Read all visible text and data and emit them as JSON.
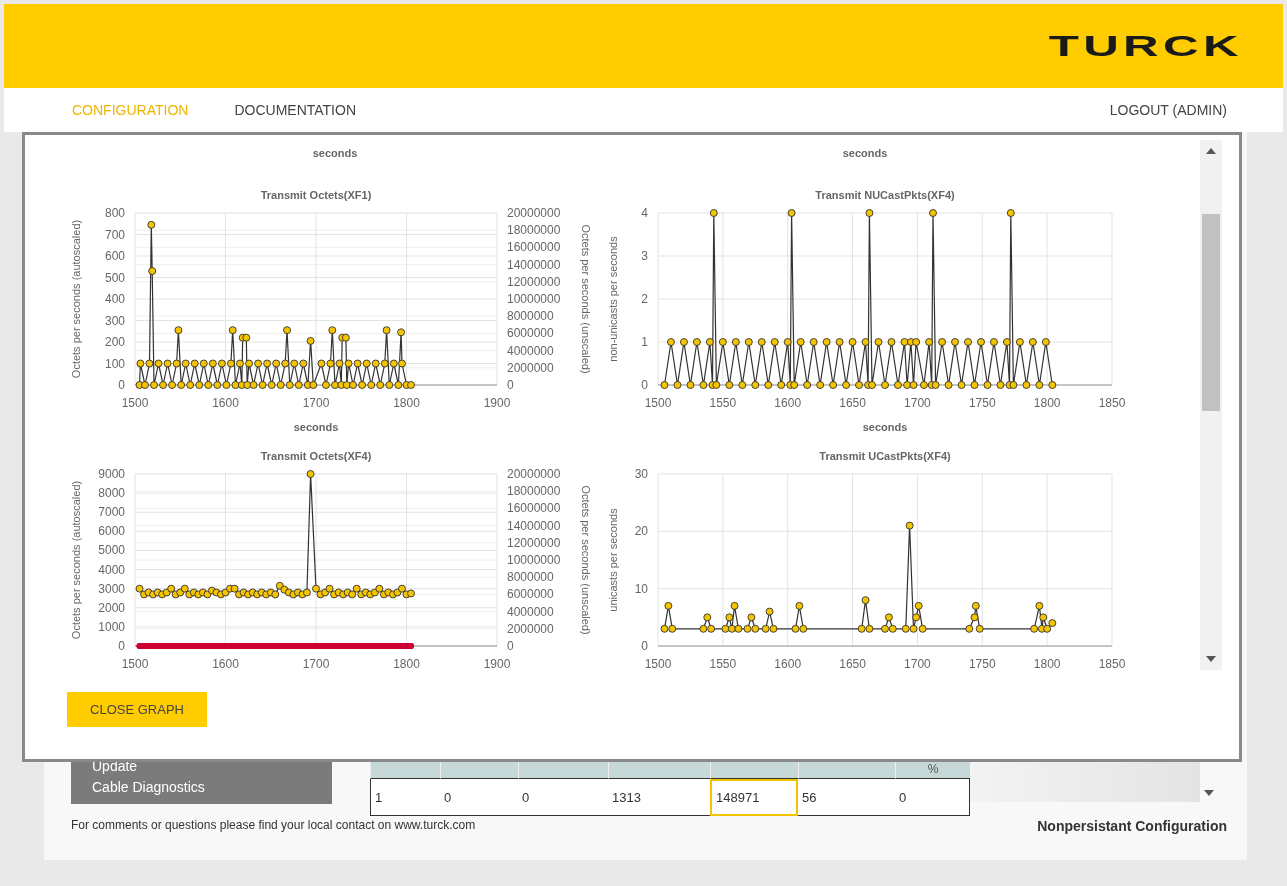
{
  "header": {
    "logo": "TURCK"
  },
  "nav": {
    "items": [
      {
        "label": "CONFIGURATION",
        "selected": true
      },
      {
        "label": "DOCUMENTATION",
        "selected": false
      }
    ],
    "logout": "LOGOUT (ADMIN)"
  },
  "graph_dialog": {
    "scrolled_labels": [
      "seconds",
      "seconds"
    ],
    "charts": [
      {
        "chart_data": {
          "type": "line",
          "grid": true,
          "title": "Transmit Octets(XF1)",
          "xlabel": "seconds",
          "ylabel": "Octets per seconds (autoscaled)",
          "y2label": "Octets per seconds (unscaled)",
          "xlim": [
            1500,
            1900
          ],
          "ylim": [
            0,
            800
          ],
          "y2lim": [
            0,
            20000000
          ],
          "xticks": [
            1500,
            1600,
            1700,
            1800,
            1900
          ],
          "yticks": [
            0,
            100,
            200,
            300,
            400,
            500,
            600,
            700,
            800
          ],
          "y2ticks": [
            0,
            2000000,
            4000000,
            6000000,
            8000000,
            10000000,
            12000000,
            14000000,
            16000000,
            18000000,
            20000000
          ],
          "x": [
            1505,
            1506,
            1511,
            1516,
            1518,
            1519,
            1521,
            1526,
            1531,
            1536,
            1541,
            1546,
            1548,
            1551,
            1556,
            1561,
            1566,
            1571,
            1576,
            1581,
            1586,
            1591,
            1596,
            1601,
            1606,
            1608,
            1611,
            1616,
            1618,
            1619,
            1623,
            1624,
            1626,
            1631,
            1636,
            1641,
            1646,
            1651,
            1656,
            1661,
            1666,
            1668,
            1671,
            1676,
            1681,
            1686,
            1691,
            1694,
            1697,
            1706,
            1711,
            1716,
            1718,
            1721,
            1726,
            1728,
            1729,
            1733,
            1734,
            1736,
            1741,
            1746,
            1751,
            1756,
            1761,
            1766,
            1771,
            1776,
            1778,
            1781,
            1786,
            1791,
            1794,
            1795,
            1800,
            1805
          ],
          "series": [
            {
              "color": "#333333",
              "marker": "circle",
              "values": [
                0,
                100,
                0,
                100,
                745,
                530,
                0,
                100,
                0,
                100,
                0,
                100,
                255,
                0,
                100,
                0,
                100,
                0,
                100,
                0,
                100,
                0,
                100,
                0,
                100,
                255,
                0,
                100,
                0,
                220,
                220,
                0,
                100,
                0,
                100,
                0,
                100,
                0,
                100,
                0,
                100,
                255,
                0,
                100,
                0,
                100,
                0,
                205,
                0,
                100,
                0,
                100,
                255,
                0,
                100,
                0,
                220,
                220,
                0,
                100,
                0,
                100,
                0,
                100,
                0,
                100,
                0,
                100,
                255,
                0,
                100,
                0,
                245,
                100,
                0,
                0
              ]
            }
          ]
        }
      },
      {
        "chart_data": {
          "type": "line",
          "grid": true,
          "title": "Transmit NUCastPkts(XF4)",
          "xlabel": "seconds",
          "ylabel": "non-unicasts per seconds",
          "xlim": [
            1500,
            1850
          ],
          "ylim": [
            0,
            4
          ],
          "xticks": [
            1500,
            1550,
            1600,
            1650,
            1700,
            1750,
            1800,
            1850
          ],
          "yticks": [
            0,
            1,
            2,
            3,
            4
          ],
          "x": [
            1505,
            1510,
            1515,
            1520,
            1525,
            1530,
            1535,
            1540,
            1542,
            1543,
            1545,
            1550,
            1555,
            1560,
            1565,
            1570,
            1575,
            1580,
            1585,
            1590,
            1595,
            1600,
            1602,
            1603,
            1605,
            1610,
            1615,
            1620,
            1625,
            1630,
            1635,
            1640,
            1645,
            1650,
            1655,
            1660,
            1662,
            1663,
            1665,
            1670,
            1675,
            1680,
            1685,
            1690,
            1692,
            1695,
            1697,
            1699,
            1705,
            1709,
            1711,
            1712,
            1714,
            1719,
            1724,
            1729,
            1734,
            1739,
            1744,
            1749,
            1754,
            1759,
            1764,
            1769,
            1771,
            1772,
            1774,
            1779,
            1784,
            1789,
            1794,
            1799,
            1804
          ],
          "series": [
            {
              "color": "#333333",
              "marker": "circle",
              "values": [
                0,
                1,
                0,
                1,
                0,
                1,
                0,
                1,
                0,
                4,
                0,
                1,
                0,
                1,
                0,
                1,
                0,
                1,
                0,
                1,
                0,
                1,
                0,
                4,
                0,
                1,
                0,
                1,
                0,
                1,
                0,
                1,
                0,
                1,
                0,
                1,
                0,
                4,
                0,
                1,
                0,
                1,
                0,
                1,
                0,
                1,
                0,
                1,
                0,
                1,
                0,
                4,
                0,
                1,
                0,
                1,
                0,
                1,
                0,
                1,
                0,
                1,
                0,
                1,
                0,
                4,
                0,
                1,
                0,
                1,
                0,
                1,
                0
              ]
            }
          ]
        }
      },
      {
        "chart_data": {
          "type": "line",
          "grid": true,
          "title": "Transmit Octets(XF4)",
          "ylabel": "Octets per seconds (autoscaled)",
          "y2label": "Octets per seconds (unscaled)",
          "xlim": [
            1500,
            1900
          ],
          "ylim": [
            0,
            9000
          ],
          "y2lim": [
            0,
            20000000
          ],
          "xticks": [
            1500,
            1600,
            1700,
            1800,
            1900
          ],
          "yticks": [
            0,
            1000,
            2000,
            3000,
            4000,
            5000,
            6000,
            7000,
            8000,
            9000
          ],
          "y2ticks": [
            0,
            2000000,
            4000000,
            6000000,
            8000000,
            10000000,
            12000000,
            14000000,
            16000000,
            18000000,
            20000000
          ],
          "x": [
            1505,
            1510,
            1515,
            1520,
            1525,
            1530,
            1535,
            1540,
            1545,
            1550,
            1555,
            1560,
            1565,
            1570,
            1575,
            1580,
            1585,
            1590,
            1595,
            1600,
            1605,
            1610,
            1615,
            1620,
            1625,
            1630,
            1635,
            1640,
            1645,
            1650,
            1655,
            1660,
            1665,
            1670,
            1675,
            1680,
            1685,
            1690,
            1694,
            1700,
            1705,
            1710,
            1715,
            1720,
            1725,
            1730,
            1735,
            1740,
            1745,
            1750,
            1755,
            1760,
            1765,
            1770,
            1775,
            1780,
            1785,
            1790,
            1795,
            1800,
            1805
          ],
          "series": [
            {
              "color": "#cc0033",
              "marker": "dot",
              "values": [
                0,
                0,
                0,
                0,
                0,
                0,
                0,
                0,
                0,
                0,
                0,
                0,
                0,
                0,
                0,
                0,
                0,
                0,
                0,
                0,
                0,
                0,
                0,
                0,
                0,
                0,
                0,
                0,
                0,
                0,
                0,
                0,
                0,
                0,
                0,
                0,
                0,
                0,
                0,
                0,
                0,
                0,
                0,
                0,
                0,
                0,
                0,
                0,
                0,
                0,
                0,
                0,
                0,
                0,
                0,
                0,
                0,
                0,
                0,
                0,
                0
              ]
            },
            {
              "color": "#333333",
              "marker": "circle",
              "values": [
                3000,
                2700,
                2800,
                2700,
                2800,
                2700,
                2800,
                3000,
                2700,
                2800,
                3000,
                2700,
                2800,
                2700,
                2800,
                2700,
                2900,
                2800,
                2700,
                2800,
                3000,
                3000,
                2700,
                2800,
                2700,
                2800,
                2700,
                2800,
                2700,
                2800,
                2700,
                3150,
                2950,
                2800,
                2700,
                2800,
                2700,
                2800,
                9000,
                3000,
                2700,
                2800,
                3000,
                2700,
                2800,
                2700,
                2800,
                2700,
                3000,
                2700,
                2800,
                2700,
                2800,
                3000,
                2700,
                2800,
                2700,
                2800,
                3000,
                2700,
                2750
              ]
            }
          ]
        }
      },
      {
        "chart_data": {
          "type": "line",
          "grid": true,
          "title": "Transmit UCastPkts(XF4)",
          "ylabel": "unicasts per seconds",
          "xlim": [
            1500,
            1850
          ],
          "ylim": [
            0,
            30
          ],
          "xticks": [
            1500,
            1550,
            1600,
            1650,
            1700,
            1750,
            1800,
            1850
          ],
          "yticks": [
            0,
            10,
            20,
            30
          ],
          "x": [
            1505,
            1508,
            1511,
            1535,
            1538,
            1541,
            1552,
            1555,
            1557,
            1559,
            1562,
            1569,
            1572,
            1575,
            1583,
            1586,
            1589,
            1606,
            1609,
            1612,
            1657,
            1660,
            1663,
            1675,
            1678,
            1681,
            1691,
            1694,
            1697,
            1699,
            1701,
            1704,
            1740,
            1744,
            1745,
            1748,
            1790,
            1794,
            1796,
            1797,
            1800,
            1804
          ],
          "series": [
            {
              "color": "#333333",
              "marker": "circle",
              "values": [
                3,
                7,
                3,
                3,
                5,
                3,
                3,
                5,
                3,
                7,
                3,
                3,
                5,
                3,
                3,
                6,
                3,
                3,
                7,
                3,
                3,
                8,
                3,
                3,
                5,
                3,
                3,
                21,
                3,
                5,
                7,
                3,
                3,
                5,
                7,
                3,
                3,
                7,
                3,
                5,
                3,
                4
              ]
            }
          ]
        }
      }
    ],
    "close_button": "CLOSE GRAPH"
  },
  "sidebar": {
    "items": [
      "Update",
      "Cable Diagnostics"
    ]
  },
  "table": {
    "header_unit": "%",
    "rows": [
      {
        "cells": [
          {
            "text": "1",
            "focused": false
          },
          {
            "text": "0",
            "focused": false
          },
          {
            "text": "0",
            "focused": false
          },
          {
            "text": "1313",
            "focused": false
          },
          {
            "text": "148971",
            "focused": true
          },
          {
            "text": "56",
            "focused": false
          },
          {
            "text": "0",
            "focused": false
          }
        ]
      }
    ]
  },
  "footer": {
    "contact": "For comments or questions please find your local contact on www.turck.com",
    "mode": "Nonpersistant Configuration"
  }
}
